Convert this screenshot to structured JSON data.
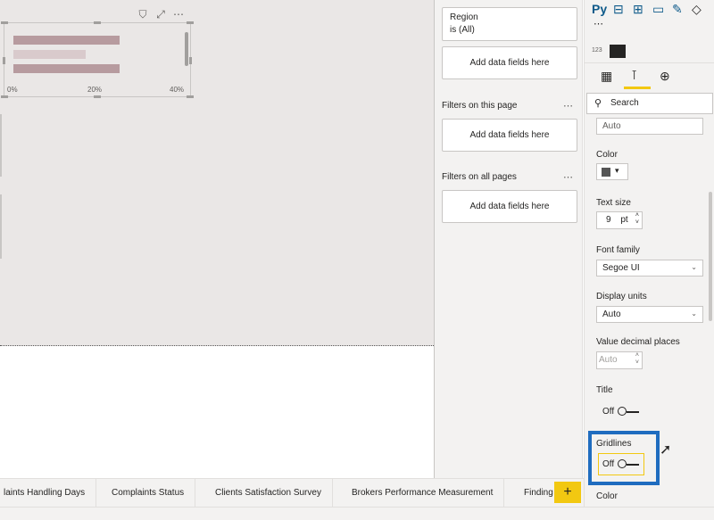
{
  "visual": {
    "toolbar": {
      "filter_icon": "filter-icon",
      "focus_icon": "focus-mode-icon",
      "more": "⋯"
    },
    "axis_ticks": [
      "0%",
      "20%",
      "40%"
    ]
  },
  "chart_data": {
    "type": "bar",
    "orientation": "horizontal",
    "categories": [
      "",
      "",
      ""
    ],
    "values": [
      0.25,
      0.17,
      0.25
    ],
    "xlim": [
      0,
      0.4
    ],
    "tick_labels": [
      "0%",
      "20%",
      "40%"
    ],
    "grid": false
  },
  "filters": {
    "region_card": {
      "title": "Region",
      "value": "is (All)"
    },
    "visual_add": "Add data fields here",
    "page_section": "Filters on this page",
    "page_add": "Add data fields here",
    "all_section": "Filters on all pages",
    "all_add": "Add data fields here",
    "more": "⋯"
  },
  "viz": {
    "py_label": "Py",
    "more": "⋯",
    "search_placeholder": "Search",
    "auto_box": "Auto",
    "color_label": "Color",
    "text_size_label": "Text size",
    "text_size_value": "9",
    "text_size_unit": "pt",
    "font_family_label": "Font family",
    "font_family_value": "Segoe UI",
    "display_units_label": "Display units",
    "display_units_value": "Auto",
    "decimal_label": "Value decimal places",
    "decimal_value": "Auto",
    "title_label": "Title",
    "title_toggle": "Off",
    "gridlines_label": "Gridlines",
    "gridlines_toggle": "Off",
    "color_label2": "Color",
    "highlight_color": "#1f6cbf",
    "accent_color": "#f2c811"
  },
  "tabs": [
    "laints Handling Days",
    "Complaints Status",
    "Clients Satisfaction Survey",
    "Brokers Performance Measurement",
    "Finding"
  ],
  "add_page_label": "+"
}
